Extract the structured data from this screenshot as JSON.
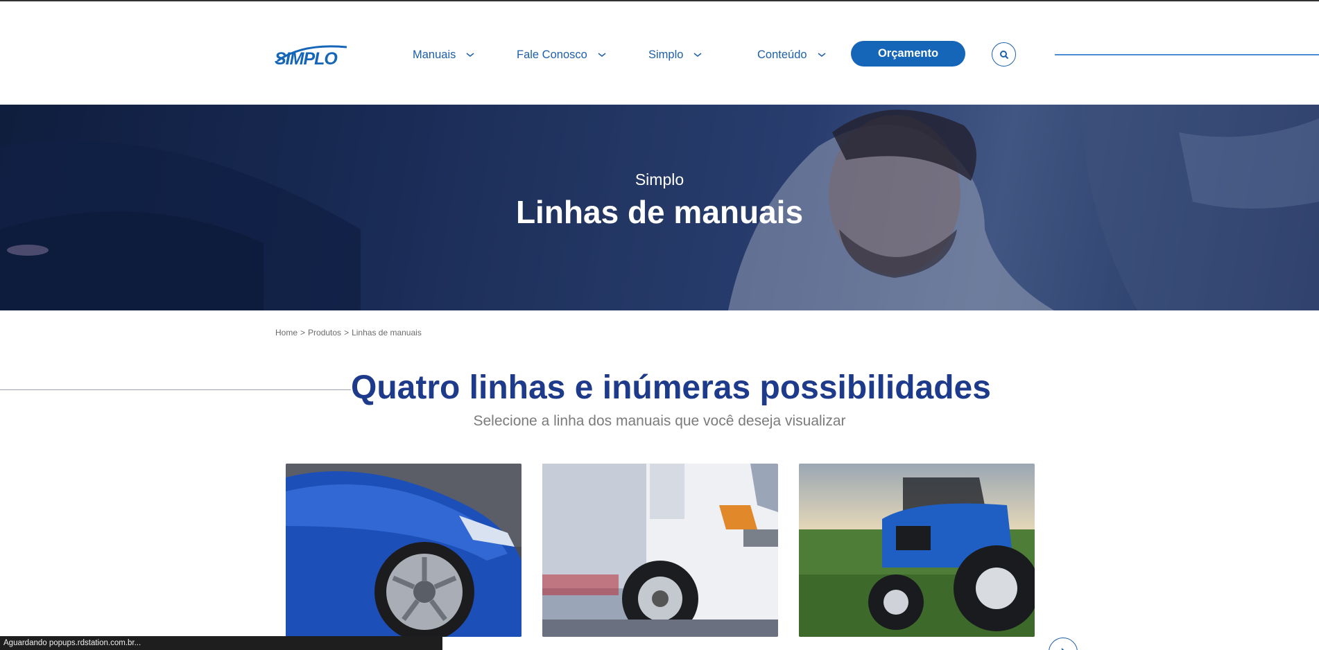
{
  "header": {
    "logo_text": "SIMPLO",
    "nav": [
      {
        "label": "Manuais"
      },
      {
        "label": "Fale Conosco"
      },
      {
        "label": "Simplo"
      },
      {
        "label": "Conteúdo"
      }
    ],
    "cta_label": "Orçamento",
    "search_icon": "search-icon"
  },
  "hero": {
    "subtitle": "Simplo",
    "title": "Linhas de manuais"
  },
  "breadcrumb": {
    "items": [
      "Home",
      "Produtos",
      "Linhas de manuais"
    ],
    "separator": ">"
  },
  "section": {
    "title": "Quatro linhas e inúmeras possibilidades",
    "subtitle": "Selecione a linha dos manuais que você deseja visualizar"
  },
  "cards": [
    {
      "image": "blue-car"
    },
    {
      "image": "white-truck"
    },
    {
      "image": "blue-tractor"
    }
  ],
  "status_bar": {
    "text": "Aguardando popups.rdstation.com.br..."
  },
  "colors": {
    "brand_blue": "#1565b8",
    "heading_blue": "#1e3a8a",
    "nav_blue": "#1d5fa8"
  }
}
